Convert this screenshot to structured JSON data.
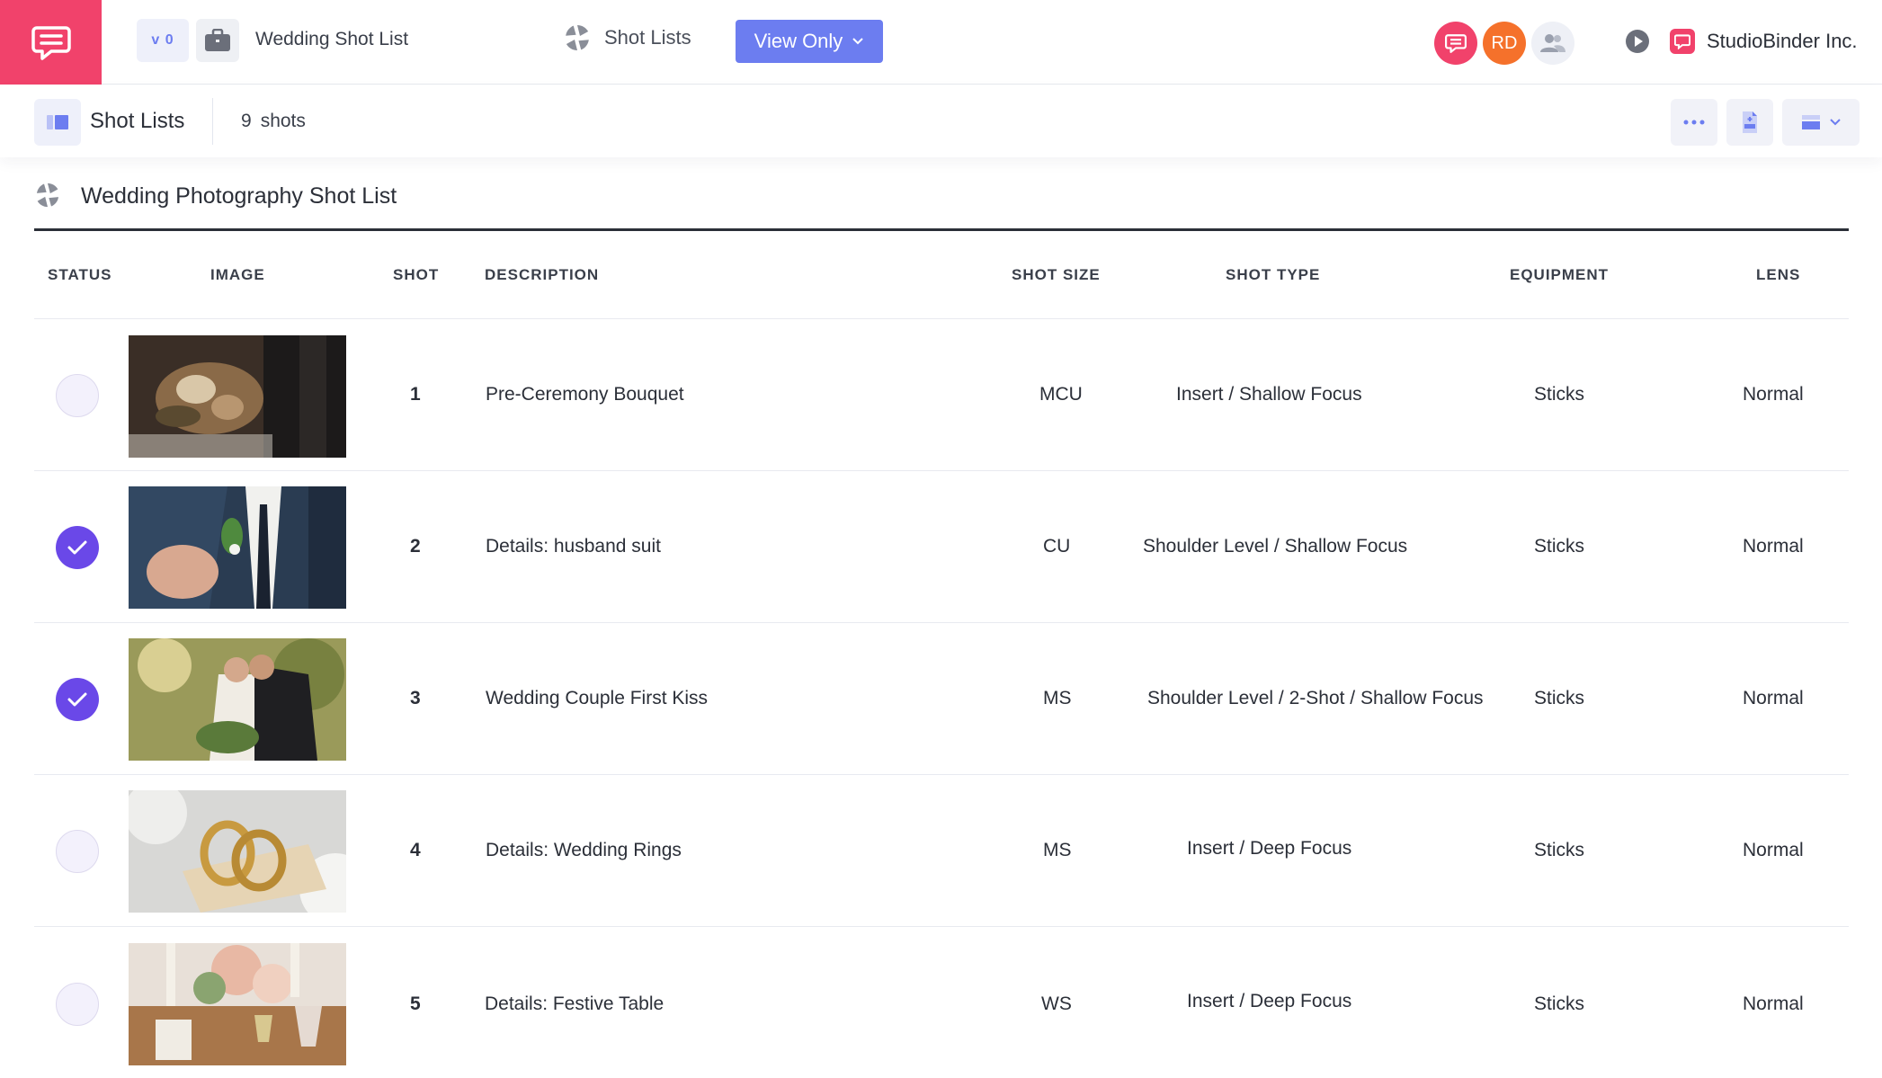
{
  "topbar": {
    "version": "v 0",
    "project_title": "Wedding Shot List",
    "nav_label": "Shot Lists",
    "view_mode": "View Only",
    "avatars": [
      {
        "label": "",
        "color": "#f1426b"
      },
      {
        "label": "RD",
        "color": "#f5712b"
      },
      {
        "label": "",
        "color": "#eef0f6"
      }
    ],
    "company": "StudioBinder Inc."
  },
  "subbar": {
    "title": "Shot Lists",
    "shot_count": "9",
    "shot_count_unit": "shots"
  },
  "list": {
    "title": "Wedding Photography Shot List",
    "columns": {
      "status": "STATUS",
      "image": "IMAGE",
      "shot": "SHOT",
      "description": "DESCRIPTION",
      "shot_size": "SHOT SIZE",
      "shot_type": "SHOT TYPE",
      "equipment": "EQUIPMENT",
      "lens": "LENS"
    },
    "rows": [
      {
        "done": false,
        "image": "bouquet-photo",
        "shot": "1",
        "description": "Pre-Ceremony Bouquet",
        "size": "MCU",
        "type": "Insert / Shallow Focus",
        "equipment": "Sticks",
        "lens": "Normal"
      },
      {
        "done": true,
        "image": "suit-boutonniere-photo",
        "shot": "2",
        "description": "Details: husband suit",
        "size": "CU",
        "type": "Shoulder Level / Shallow Focus",
        "equipment": "Sticks",
        "lens": "Normal"
      },
      {
        "done": true,
        "image": "couple-kiss-photo",
        "shot": "3",
        "description": "Wedding Couple First Kiss",
        "size": "MS",
        "type": "Shoulder Level / 2-Shot / Shallow Focus",
        "equipment": "Sticks",
        "lens": "Normal"
      },
      {
        "done": false,
        "image": "wedding-rings-photo",
        "shot": "4",
        "description": "Details: Wedding Rings",
        "size": "MS",
        "type": "Insert / Deep Focus",
        "equipment": "Sticks",
        "lens": "Normal"
      },
      {
        "done": false,
        "image": "festive-table-photo",
        "shot": "5",
        "description": "Details: Festive Table",
        "size": "WS",
        "type": "Insert / Deep Focus",
        "equipment": "Sticks",
        "lens": "Normal"
      }
    ]
  },
  "colors": {
    "brand": "#f1426b",
    "accent": "#6c7df0",
    "check": "#6a48e8"
  }
}
